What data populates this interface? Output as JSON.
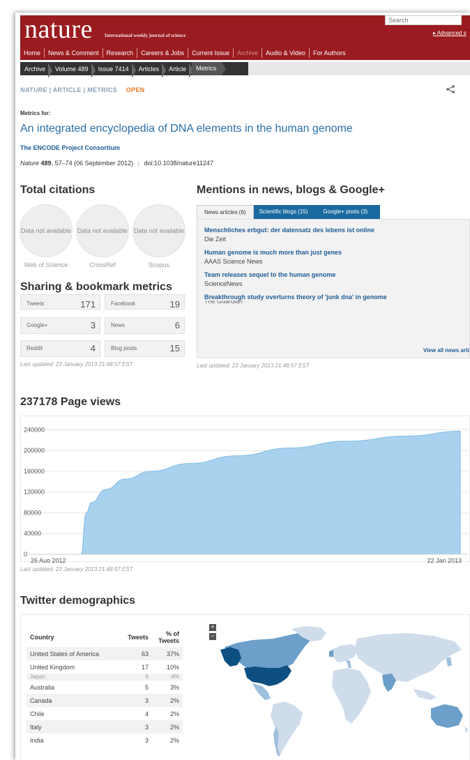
{
  "header": {
    "logo": "nature",
    "tagline": "International weekly journal of science",
    "search_placeholder": "Search",
    "advanced": "▸ Advanced s",
    "nav": [
      "Home",
      "News & Comment",
      "Research",
      "Careers & Jobs",
      "Current Issue",
      "Archive",
      "Audio & Video",
      "For Authors"
    ],
    "breadcrumbs": [
      "Archive",
      "Volume 489",
      "Issue 7414",
      "Articles",
      "Article",
      "Metrics"
    ]
  },
  "article": {
    "journal": "NATURE",
    "type": "ARTICLE",
    "section": "METRICS",
    "access": "OPEN",
    "metrics_for": "Metrics for:",
    "title": "An integrated encyclopedia of DNA elements in the human genome",
    "author": "The ENCODE Project Consortium",
    "journal_name": "Nature",
    "volume": "489",
    "pages": ", 57–74",
    "date": "(06 September 2012)",
    "doi": "doi:10.1038/nature11247"
  },
  "citations": {
    "heading": "Total citations",
    "items": [
      {
        "value": "Data not available",
        "label": "Web of Science"
      },
      {
        "value": "Data not available",
        "label": "CrossRef"
      },
      {
        "value": "Data not available",
        "label": "Scopus"
      }
    ]
  },
  "sharing": {
    "heading": "Sharing & bookmark metrics",
    "items": [
      {
        "label": "Tweets",
        "value": "171"
      },
      {
        "label": "Facebook",
        "value": "19"
      },
      {
        "label": "Google+",
        "value": "3"
      },
      {
        "label": "News",
        "value": "6"
      },
      {
        "label": "Reddit",
        "value": "4"
      },
      {
        "label": "Blog posts",
        "value": "15"
      }
    ],
    "updated": "Last updated: 23 January 2013 21:48:57 EST"
  },
  "mentions": {
    "heading": "Mentions in news, blogs & Google+",
    "tabs": [
      "News articles (6)",
      "Scientific blogs (15)",
      "Google+ posts (3)"
    ],
    "items": [
      {
        "title": "Menschliches erbgut: der datensatz des lebens ist online",
        "source": "Die Zeit"
      },
      {
        "title": "Human genome is much more than just genes",
        "source": "AAAS Science News"
      },
      {
        "title": "Team releases sequel to the human genome",
        "source": "ScienceNews"
      },
      {
        "title": "Breakthrough study overturns theory of 'junk dna' in genome",
        "source": "The Guardian"
      }
    ],
    "view_all": "View all news arti",
    "updated": "Last updated: 23 January 2013 21:48:57 EST"
  },
  "pageviews": {
    "heading": "237178 Page views",
    "updated": "Last updated: 23 January 2013 21:48:57 EST"
  },
  "chart_data": {
    "type": "area",
    "title": "237178 Page views",
    "x_start_label": "26 Aug 2012",
    "x_end_label": "22 Jan 2013",
    "x": [
      "26 Aug 2012",
      "6 Sep 2012",
      "8 Sep 2012",
      "10 Sep 2012",
      "15 Sep 2012",
      "22 Sep 2012",
      "1 Oct 2012",
      "15 Oct 2012",
      "1 Nov 2012",
      "20 Nov 2012",
      "10 Dec 2012",
      "1 Jan 2013",
      "22 Jan 2013"
    ],
    "values": [
      0,
      0,
      80000,
      100000,
      125000,
      145000,
      160000,
      175000,
      190000,
      205000,
      218000,
      228000,
      237178
    ],
    "yticks": [
      0,
      40000,
      80000,
      120000,
      160000,
      200000,
      240000
    ],
    "ylim": [
      0,
      250000
    ],
    "grid": true,
    "color": "#a9d2ef",
    "xlabel": "",
    "ylabel": ""
  },
  "twitter": {
    "heading": "Twitter demographics",
    "columns": [
      "Country",
      "Tweets",
      "% of Tweets"
    ],
    "rows": [
      {
        "country": "United States of America",
        "tweets": "63",
        "pct": "37%"
      },
      {
        "country": "United Kingdom",
        "tweets": "17",
        "pct": "10%"
      },
      {
        "country": "Japan",
        "tweets": "6",
        "pct": "4%"
      },
      {
        "country": "Australia",
        "tweets": "5",
        "pct": "3%"
      },
      {
        "country": "Canada",
        "tweets": "3",
        "pct": "2%"
      },
      {
        "country": "Chile",
        "tweets": "4",
        "pct": "2%"
      },
      {
        "country": "Italy",
        "tweets": "3",
        "pct": "2%"
      },
      {
        "country": "India",
        "tweets": "3",
        "pct": "2%"
      }
    ],
    "zoom_in": "+",
    "zoom_out": "−"
  }
}
